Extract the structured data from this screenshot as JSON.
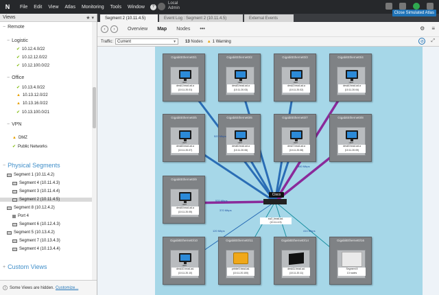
{
  "menubar": {
    "logo": "N",
    "items": [
      "File",
      "Edit",
      "View",
      "Atlas",
      "Monitoring",
      "Tools",
      "Window"
    ],
    "user_line1": "Local",
    "user_line2": "Admin",
    "tooltip": "Close Simulated Atlas"
  },
  "left": {
    "header": "Views",
    "header_ctrl": "★ ▾",
    "remote": "Remote",
    "logistic": "Logistic",
    "logistic_items": [
      "10.12.4.0/22",
      "10.12.12.0/22",
      "10.12.100.0/22"
    ],
    "office": "Office",
    "office_items": [
      "10.13.4.0/22",
      "10.13.12.0/22",
      "10.13.16.0/22",
      "10.13.100.0/21"
    ],
    "vpn": "VPN",
    "dmz": "DMZ",
    "public": "Public Networks",
    "physical_title": "Physical Segments",
    "segments": [
      "Segment 1 (10.11.4.2)",
      "Segment 4 (10.11.4.3)",
      "Segment 3 (10.11.4.4)",
      "Segment 2 (10.11.4.5)",
      "Segment 8 (10.12.4.2)",
      "Port 4",
      "Segment 6 (10.12.4.3)",
      "Segment 5 (10.13.4.2)",
      "Segment 7 (10.13.4.3)",
      "Segment 4 (10.13.4.4)"
    ],
    "custom_title": "Custom Views",
    "footer_text": "Some Views are hidden.",
    "footer_link": "Customize..."
  },
  "tabs": [
    "Segment 2 (10.11.4.5)",
    "Event Log : Segment 2 (10.11.4.5)",
    "External Events"
  ],
  "toolbar": {
    "back": "‹",
    "forward": "›",
    "views": [
      "Overview",
      "Map",
      "Nodes"
    ],
    "more": "•••",
    "right": [
      "⚙",
      "≡"
    ]
  },
  "filter": {
    "label": "Traffic:",
    "value": "Current",
    "nodes_count": "13",
    "nodes_label": "Nodes",
    "warn_count": "1",
    "warn_label": "Warning",
    "expand": "⤢"
  },
  "colors": {
    "link_blue": "#2a6db5",
    "link_purple": "#8a2a9a",
    "link_teal": "#1a8fa0",
    "accent": "#1f73b7"
  },
  "map": {
    "hub_name": "Cisco",
    "hub_label": [
      "sw2_head.ad.",
      "(10.11.4.5)"
    ],
    "nodes": [
      {
        "title": "GigabitEthernet0/1",
        "type": "desk",
        "label1": "desk1.head.ad.a",
        "label2": "(10.11.20.01)"
      },
      {
        "title": "GigabitEthernet0/2",
        "type": "desk",
        "label1": "desk3.head.ad.a",
        "label2": "(10.11.20.03)"
      },
      {
        "title": "GigabitEthernet0/3",
        "type": "desk",
        "label1": "desk2.head.ad.a",
        "label2": "(10.11.20.02)"
      },
      {
        "title": "GigabitEthernet0/4",
        "type": "desk",
        "label1": "desk4.head.ad.a",
        "label2": "(10.11.20.04)"
      },
      {
        "title": "GigabitEthernet0/5",
        "type": "desk",
        "label1": "desk8.head.ad.a",
        "label2": "(10.11.20.07)"
      },
      {
        "title": "GigabitEthernet0/6",
        "type": "desk",
        "label1": "desk6.head.ad.a",
        "label2": "(10.11.20.06)"
      },
      {
        "title": "GigabitEthernet0/7",
        "type": "desk",
        "label1": "desk7.head.ad.a",
        "label2": "(10.11.20.08)"
      },
      {
        "title": "GigabitEthernet0/8",
        "type": "desk",
        "label1": "desk9.head.ad.a",
        "label2": "(10.11.20.09)"
      },
      {
        "title": "GigabitEthernet0/9",
        "type": "desk",
        "label1": "desk5.head.ad.a",
        "label2": "(10.11.20.05)"
      },
      {
        "title": "GigabitEthernet0/10",
        "type": "desk",
        "label1": "desk10.head.ad.",
        "label2": "(10.11.20.10)"
      },
      {
        "title": "GigabitEthernet0/11",
        "type": "printer",
        "label1": "printer0.head.ad.",
        "label2": "(10.11.20.100)"
      },
      {
        "title": "GigabitEthernet0/14",
        "type": "box",
        "label1": "desk11.head.ad.",
        "label2": "(10.11.20.11)"
      },
      {
        "title": "GigabitEthernet0/16",
        "type": "segment",
        "label1": "Segment 8",
        "label2": "13 nodes"
      }
    ],
    "link_labels": [
      "570 Mbps",
      "370 Mbps",
      "120 Mbps",
      "380 Mbps",
      "520 Mbps",
      "410 Mbps"
    ]
  }
}
